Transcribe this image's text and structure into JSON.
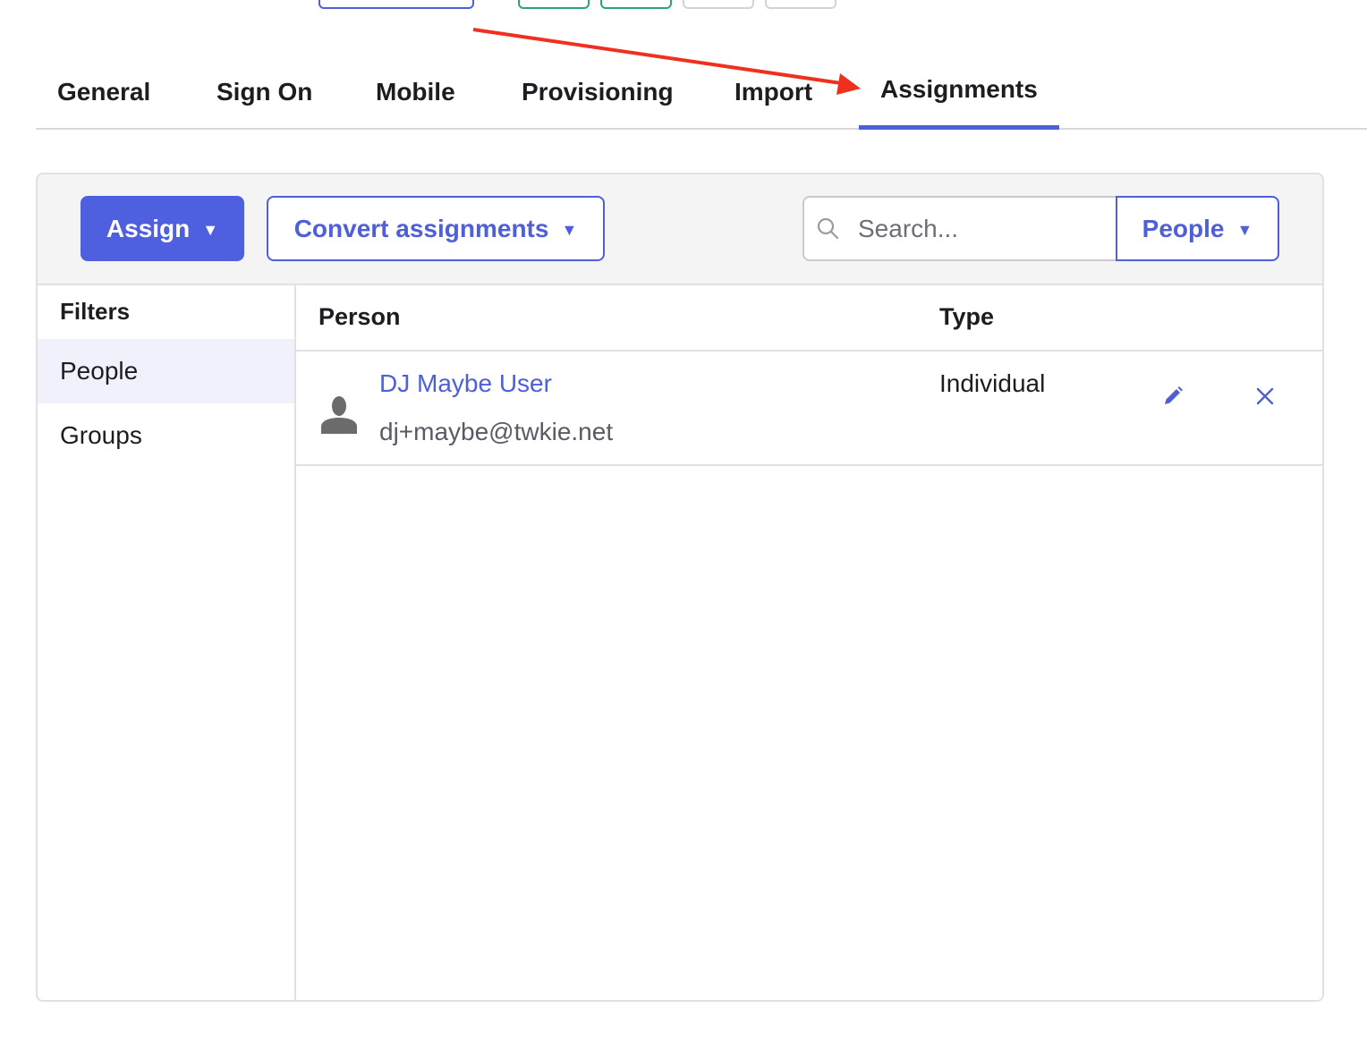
{
  "tabs": [
    {
      "label": "General"
    },
    {
      "label": "Sign On"
    },
    {
      "label": "Mobile"
    },
    {
      "label": "Provisioning"
    },
    {
      "label": "Import"
    },
    {
      "label": "Assignments"
    }
  ],
  "active_tab": "Assignments",
  "toolbar": {
    "assign_label": "Assign",
    "convert_label": "Convert assignments",
    "search_placeholder": "Search...",
    "search_value": "",
    "scope_label": "People"
  },
  "filters": {
    "title": "Filters",
    "items": [
      {
        "label": "People",
        "selected": true
      },
      {
        "label": "Groups",
        "selected": false
      }
    ]
  },
  "table": {
    "columns": [
      "Person",
      "Type"
    ],
    "rows": [
      {
        "name": "DJ Maybe User",
        "email": "dj+maybe@twkie.net",
        "type": "Individual"
      }
    ]
  },
  "colors": {
    "accent": "#4e5fe0",
    "annotation_arrow": "#f0301e",
    "selected_filter_bg": "#f1f1fb"
  },
  "icons": {
    "search": "search-icon",
    "caret": "caret-down-icon",
    "avatar": "user-silhouette-icon",
    "edit": "pencil-icon",
    "remove": "close-icon"
  }
}
